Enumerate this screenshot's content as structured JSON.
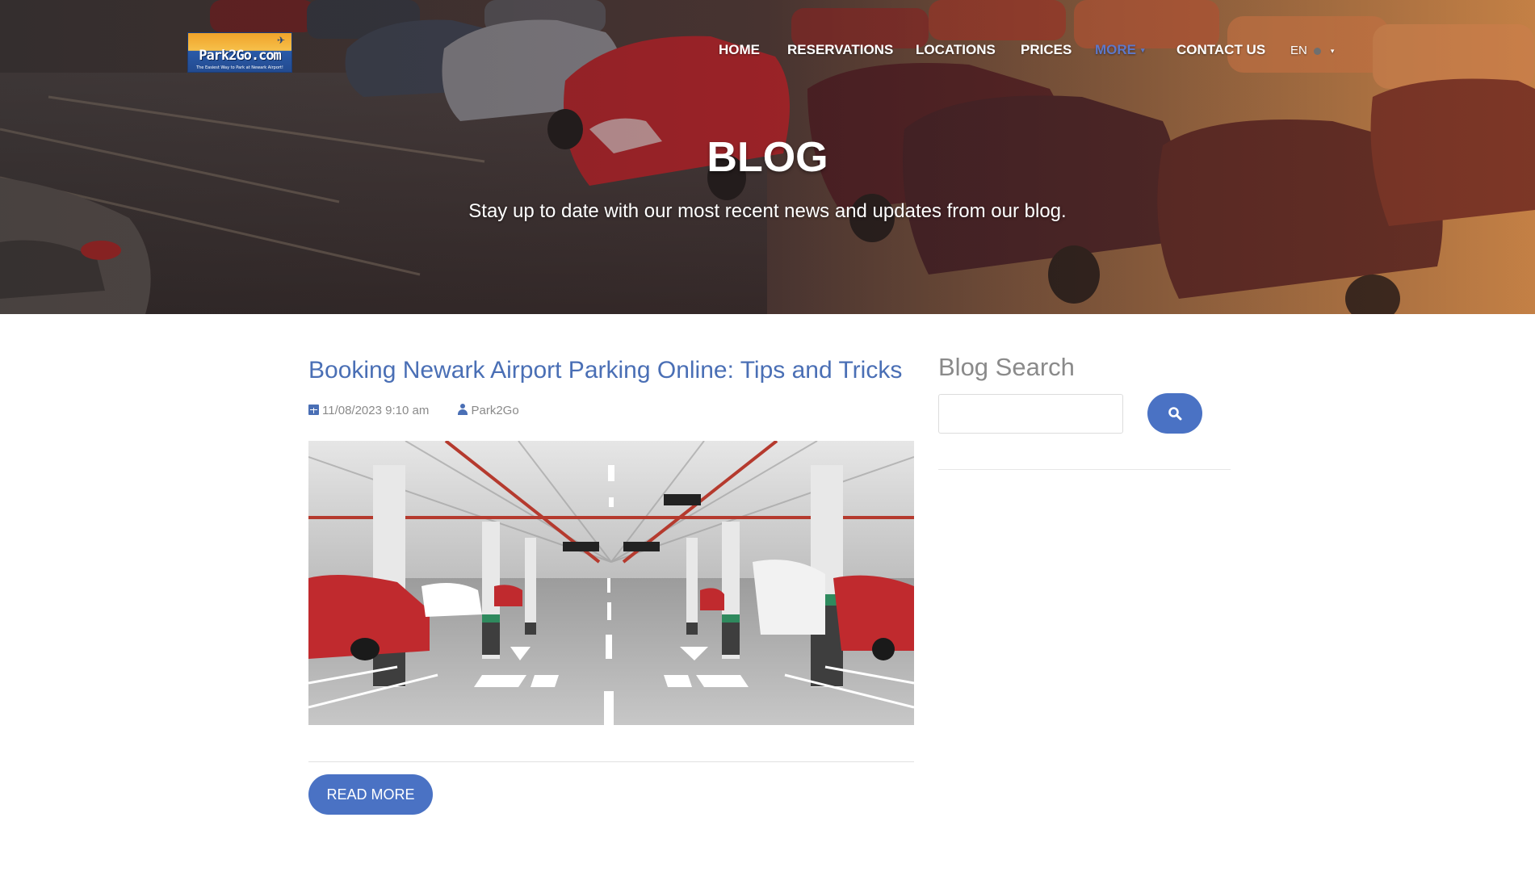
{
  "header": {
    "logo": {
      "text": "Park2Go.com",
      "tagline": "The Easiest Way to Park at Newark Airport!"
    },
    "nav": [
      {
        "label": "HOME"
      },
      {
        "label": "RESERVATIONS"
      },
      {
        "label": "LOCATIONS"
      },
      {
        "label": "PRICES"
      },
      {
        "label": "MORE"
      },
      {
        "label": "CONTACT US"
      }
    ],
    "language": "EN"
  },
  "hero": {
    "title": "BLOG",
    "subtitle": "Stay up to date with our most recent news and updates from our blog."
  },
  "post": {
    "title": "Booking Newark Airport Parking Online: Tips and Tricks",
    "date": "11/08/2023 9:10 am",
    "author": "Park2Go",
    "read_more_label": "READ MORE"
  },
  "sidebar": {
    "search_title": "Blog Search",
    "search_value": ""
  },
  "colors": {
    "accent": "#4a72c4",
    "link": "#4a6fb5",
    "nav_more": "#5d78c9",
    "muted_text": "#8a8a8a"
  },
  "icons": {
    "calendar": "calendar-icon",
    "user": "user-icon",
    "search": "search-icon",
    "globe": "globe-icon",
    "caret": "caret-down-icon"
  }
}
